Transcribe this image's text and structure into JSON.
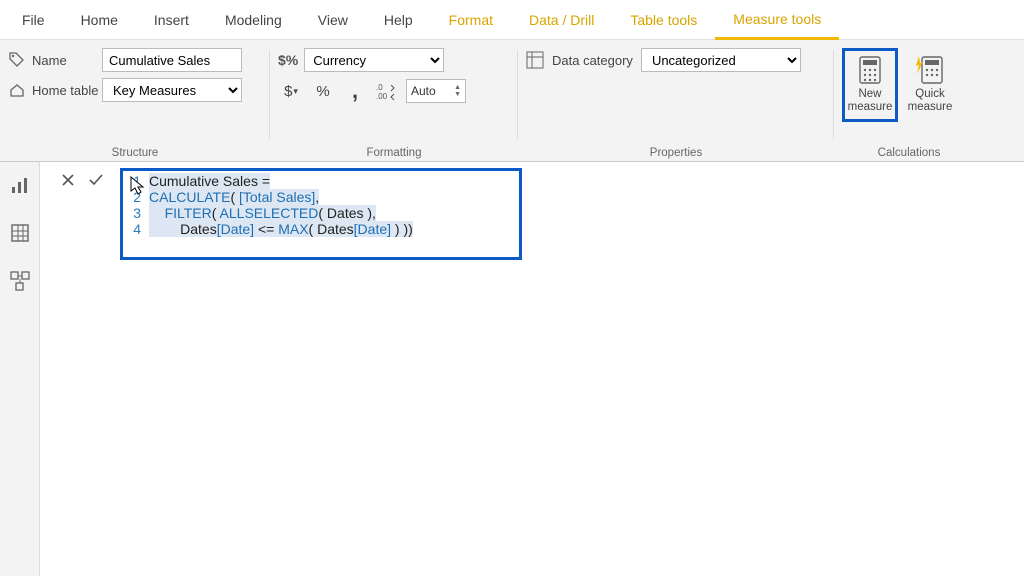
{
  "menu": {
    "file": "File",
    "home": "Home",
    "insert": "Insert",
    "modeling": "Modeling",
    "view": "View",
    "help": "Help",
    "format": "Format",
    "data_drill": "Data / Drill",
    "table_tools": "Table tools",
    "measure_tools": "Measure tools"
  },
  "ribbon": {
    "structure": {
      "name_label": "Name",
      "name_value": "Cumulative Sales",
      "home_table_label": "Home table",
      "home_table_value": "Key Measures",
      "group_label": "Structure"
    },
    "formatting": {
      "format_value": "Currency",
      "decimals_value": "Auto",
      "group_label": "Formatting",
      "dollar": "$",
      "percent": "%",
      "comma": ","
    },
    "properties": {
      "label": "Data category",
      "value": "Uncategorized",
      "group_label": "Properties"
    },
    "calculations": {
      "new_measure_l1": "New",
      "new_measure_l2": "measure",
      "quick_measure_l1": "Quick",
      "quick_measure_l2": "measure",
      "group_label": "Calculations"
    }
  },
  "formula": {
    "lines": {
      "n1": "1",
      "n2": "2",
      "n3": "3",
      "n4": "4",
      "l1": "Cumulative Sales =",
      "l2a": "CALCULATE",
      "l2b": "( ",
      "l2c": "[Total Sales]",
      "l2d": ",",
      "l3a": "    ",
      "l3b": "FILTER",
      "l3c": "( ",
      "l3d": "ALLSELECTED",
      "l3e": "( Dates ),",
      "l4a": "        Dates",
      "l4b": "[Date]",
      "l4c": " <= ",
      "l4d": "MAX",
      "l4e": "( Dates",
      "l4f": "[Date]",
      "l4g": " ) ))"
    }
  }
}
